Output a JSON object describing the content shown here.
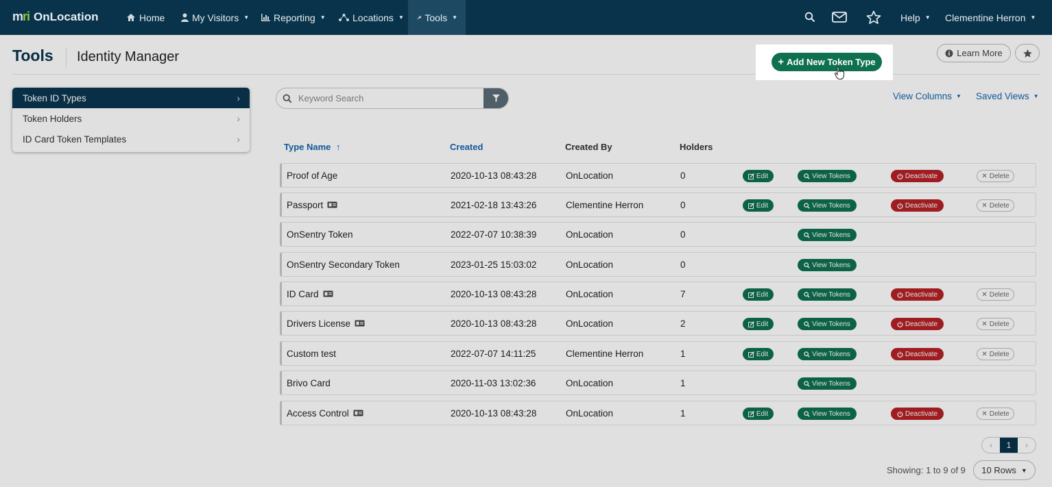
{
  "nav": {
    "brand_mark": "mri",
    "brand_name": "OnLocation",
    "items": [
      {
        "label": "Home",
        "icon": "home-icon"
      },
      {
        "label": "My Visitors",
        "icon": "user-icon"
      },
      {
        "label": "Reporting",
        "icon": "chart-icon"
      },
      {
        "label": "Locations",
        "icon": "network-icon"
      },
      {
        "label": "Tools",
        "icon": "wrench-icon"
      }
    ],
    "help": "Help",
    "user": "Clementine Herron"
  },
  "header": {
    "title": "Tools",
    "subtitle": "Identity Manager",
    "learn_more": "Learn More"
  },
  "sidebar": {
    "items": [
      {
        "label": "Token ID Types"
      },
      {
        "label": "Token Holders"
      },
      {
        "label": "ID Card Token Templates"
      }
    ]
  },
  "search": {
    "placeholder": "Keyword Search"
  },
  "toolbar": {
    "add_label": "Add New Token Type",
    "view_columns": "View Columns",
    "saved_views": "Saved Views"
  },
  "table": {
    "columns": [
      "Type Name",
      "Created",
      "Created By",
      "Holders"
    ],
    "sort_arrow": "↑",
    "actions": {
      "edit": "Edit",
      "view": "View Tokens",
      "deactivate": "Deactivate",
      "delete": "Delete"
    },
    "rows": [
      {
        "name": "Proof of Age",
        "card": false,
        "created": "2020-10-13 08:43:28",
        "by": "OnLocation",
        "holders": "0",
        "full": true
      },
      {
        "name": "Passport",
        "card": true,
        "created": "2021-02-18 13:43:26",
        "by": "Clementine Herron",
        "holders": "0",
        "full": true
      },
      {
        "name": "OnSentry Token",
        "card": false,
        "created": "2022-07-07 10:38:39",
        "by": "OnLocation",
        "holders": "0",
        "full": false
      },
      {
        "name": "OnSentry Secondary Token",
        "card": false,
        "created": "2023-01-25 15:03:02",
        "by": "OnLocation",
        "holders": "0",
        "full": false
      },
      {
        "name": "ID Card",
        "card": true,
        "created": "2020-10-13 08:43:28",
        "by": "OnLocation",
        "holders": "7",
        "full": true
      },
      {
        "name": "Drivers License",
        "card": true,
        "created": "2020-10-13 08:43:28",
        "by": "OnLocation",
        "holders": "2",
        "full": true
      },
      {
        "name": "Custom test",
        "card": false,
        "created": "2022-07-07 14:11:25",
        "by": "Clementine Herron",
        "holders": "1",
        "full": true
      },
      {
        "name": "Brivo Card",
        "card": false,
        "created": "2020-11-03 13:02:36",
        "by": "OnLocation",
        "holders": "1",
        "full": false
      },
      {
        "name": "Access Control",
        "card": true,
        "created": "2020-10-13 08:43:28",
        "by": "OnLocation",
        "holders": "1",
        "full": true
      }
    ]
  },
  "pagination": {
    "current": "1",
    "showing": "Showing: 1 to 9 of 9",
    "rows": "10 Rows"
  },
  "colors": {
    "nav": "#08334a",
    "primary": "#0e7050",
    "danger": "#b52126",
    "link": "#1565b0"
  }
}
